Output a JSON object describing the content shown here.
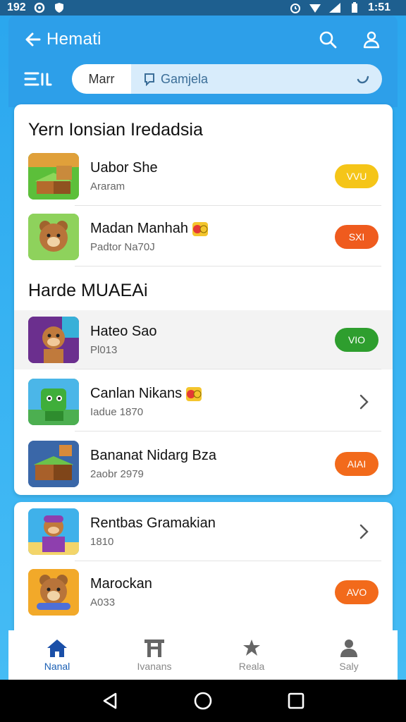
{
  "status_bar": {
    "time_left": "192",
    "time_right": "1:51"
  },
  "header": {
    "title": "Hemati",
    "segment_label": "Marr",
    "search_placeholder": "Gamjela"
  },
  "sections": [
    {
      "title": "Yern Ionsian Iredadsia",
      "items": [
        {
          "title": "Uabor She",
          "subtitle": "Araram",
          "action": "pill",
          "action_label": "VVU",
          "action_color": "#f5c518",
          "title_style": "green-tail",
          "emoji": false,
          "icon": "crate-game-icon",
          "thumb_bg": "#4caf50"
        },
        {
          "title": "Madan Manhah",
          "subtitle": "Padtor Na70J",
          "action": "pill",
          "action_label": "SXI",
          "action_color": "#ef5b1e",
          "emoji": true,
          "icon": "bear-game-icon",
          "thumb_bg": "#6cc24a"
        }
      ]
    },
    {
      "title": "Harde MUAEAi",
      "items": [
        {
          "title": "Hateo Sao",
          "subtitle": "Pl013",
          "action": "pill",
          "action_label": "VIO",
          "action_color": "#2e9e2e",
          "emoji": false,
          "icon": "monkey-game-icon",
          "thumb_bg": "#7b3fa0",
          "highlight": true
        },
        {
          "title": "Canlan Nikans",
          "subtitle": "Iadue 1870",
          "action": "chevron",
          "emoji": true,
          "icon": "robot-game-icon",
          "thumb_bg": "#3aa336"
        },
        {
          "title": "Bananat Nidarg Bza",
          "subtitle": "2aobr 2979",
          "action": "pill",
          "action_label": "AIAI",
          "action_color": "#f26a1b",
          "emoji": false,
          "icon": "crate-game-icon",
          "thumb_bg": "#3b6fb0"
        }
      ]
    }
  ],
  "more_items": [
    {
      "title": "Rentbas Gramakian",
      "subtitle": "1810",
      "action": "chevron",
      "icon": "monkey-game-icon",
      "thumb_bg": "#2ba3e0"
    },
    {
      "title": "Marockan",
      "subtitle": "A033",
      "action": "pill",
      "action_label": "AVO",
      "action_color": "#f26a1b",
      "icon": "bear-game-icon",
      "thumb_bg": "#f0a51f"
    }
  ],
  "bottom_nav": [
    {
      "label": "Nanal",
      "icon": "home-icon",
      "active": true
    },
    {
      "label": "Ivanans",
      "icon": "gate-icon",
      "active": false
    },
    {
      "label": "Reala",
      "icon": "puzzle-icon",
      "active": false
    },
    {
      "label": "Saly",
      "icon": "user-icon",
      "active": false
    }
  ],
  "colors": {
    "accent": "#2d9fe9",
    "nav_active": "#1a5fb4"
  }
}
